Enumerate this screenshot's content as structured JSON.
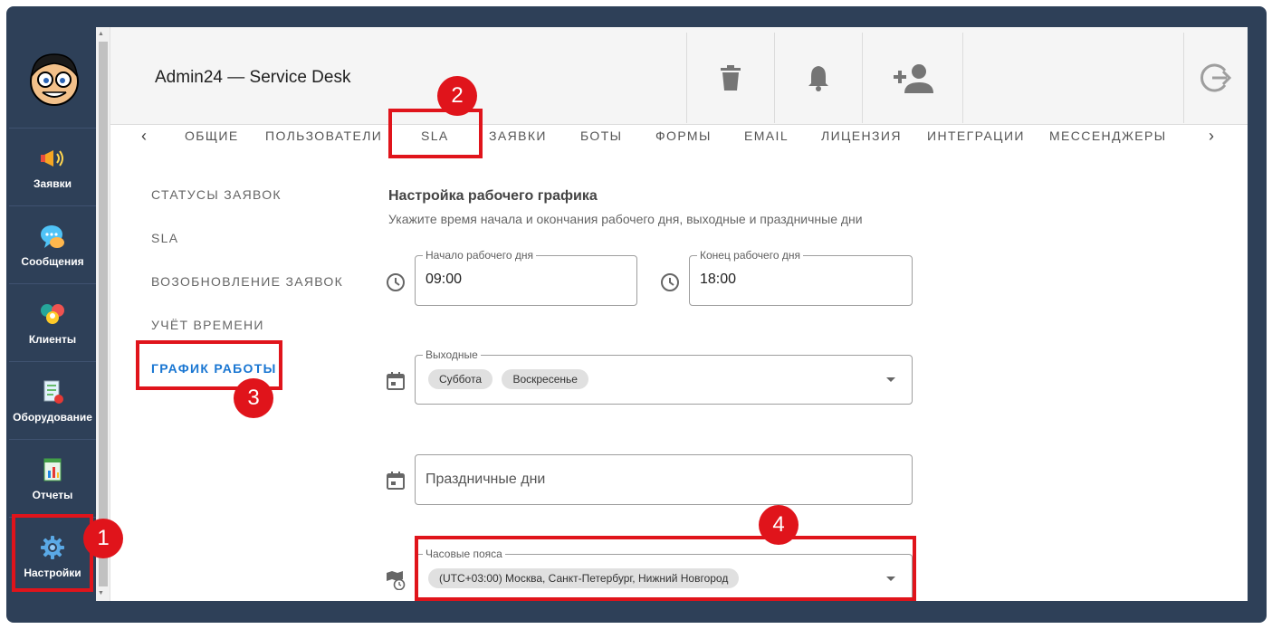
{
  "app": {
    "title": "Admin24 — Service Desk"
  },
  "sidebar": {
    "items": [
      {
        "label": "Заявки",
        "icon": "megaphone-icon"
      },
      {
        "label": "Сообщения",
        "icon": "chat-bubble-icon"
      },
      {
        "label": "Клиенты",
        "icon": "clients-icon"
      },
      {
        "label": "Оборудование",
        "icon": "equipment-icon"
      },
      {
        "label": "Отчеты",
        "icon": "reports-icon"
      },
      {
        "label": "Настройки",
        "icon": "gear-icon"
      }
    ],
    "active": "Настройки"
  },
  "header": {
    "actions": [
      "trash-icon",
      "bell-icon",
      "add-user-icon",
      "logout-icon"
    ]
  },
  "tabs": [
    {
      "label": "ОБЩИЕ"
    },
    {
      "label": "ПОЛЬЗОВАТЕЛИ"
    },
    {
      "label": "SLA"
    },
    {
      "label": "ЗАЯВКИ"
    },
    {
      "label": "БОТЫ"
    },
    {
      "label": "ФОРМЫ"
    },
    {
      "label": "EMAIL"
    },
    {
      "label": "ЛИЦЕНЗИЯ"
    },
    {
      "label": "ИНТЕГРАЦИИ"
    },
    {
      "label": "МЕССЕНДЖЕРЫ"
    }
  ],
  "left_menu": [
    {
      "label": "СТАТУСЫ ЗАЯВОК"
    },
    {
      "label": "SLA"
    },
    {
      "label": "ВОЗОБНОВЛЕНИЕ ЗАЯВОК"
    },
    {
      "label": "УЧЁТ ВРЕМЕНИ"
    },
    {
      "label": "ГРАФИК РАБОТЫ"
    }
  ],
  "active_left_menu": "ГРАФИК РАБОТЫ",
  "schedule": {
    "title": "Настройка рабочего графика",
    "subtitle": "Укажите время начала и окончания рабочего дня, выходные и праздничные дни",
    "start": {
      "label": "Начало рабочего дня",
      "value": "09:00"
    },
    "end": {
      "label": "Конец рабочего дня",
      "value": "18:00"
    },
    "weekends": {
      "label": "Выходные",
      "chips": [
        "Суббота",
        "Воскресенье"
      ]
    },
    "holidays": {
      "placeholder": "Праздничные дни"
    },
    "timezone": {
      "label": "Часовые пояса",
      "value": "(UTC+03:00) Москва, Санкт-Петербург, Нижний Новгород"
    }
  },
  "annotations": [
    "1",
    "2",
    "3",
    "4"
  ],
  "colors": {
    "sidebar": "#2e4058",
    "accent": "#1976d2",
    "annotation": "#e0141b"
  }
}
